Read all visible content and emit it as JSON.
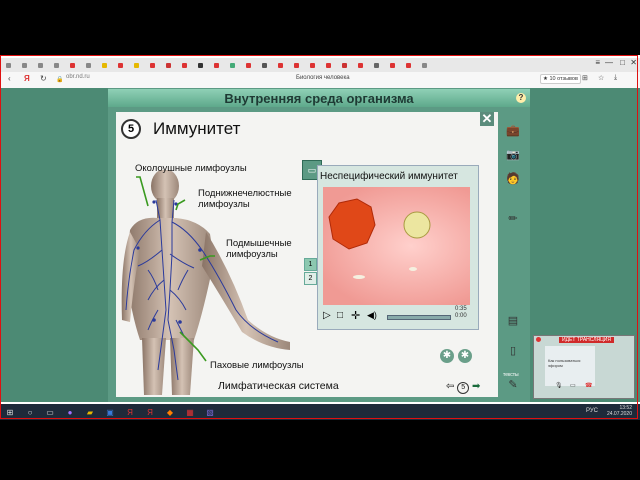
{
  "browser": {
    "url": "obr.nd.ru",
    "page_title": "Биология человека",
    "reviews_badge": "★ 10 отзывов",
    "window_controls": [
      "≡",
      "—",
      "□",
      "✕"
    ],
    "tab_icon_colors": [
      "#888",
      "#888",
      "#888",
      "#888",
      "#d33",
      "#888",
      "#e6b800",
      "#d33",
      "#e6b800",
      "#d33",
      "#c33",
      "#d33",
      "#333",
      "#d33",
      "#4a7",
      "#d33",
      "#555",
      "#d33",
      "#d33",
      "#d33",
      "#d33",
      "#c33",
      "#d33",
      "#666",
      "#d33",
      "#d33",
      "#888"
    ]
  },
  "app": {
    "title": "Внутренняя среда организма",
    "help_label": "?",
    "close_label": "✕",
    "section_number": "5",
    "heading": "Иммунитет",
    "labels": {
      "parotid": "Околоушные лимфоузлы",
      "submandibular_1": "Поднижнечелюстные",
      "submandibular_2": "лимфоузлы",
      "axillary_1": "Подмышечные",
      "axillary_2": "лимфоузлы",
      "inguinal": "Паховые лимфоузлы"
    },
    "caption": "Лимфатическая система",
    "video": {
      "title": "Неспецифический иммунитет",
      "time_total": "0:35",
      "time_current": "0:00",
      "clips": [
        "1",
        "2"
      ],
      "active_clip": 0,
      "progress": 0.0
    },
    "page_number": "5",
    "tools": [
      "briefcase-icon",
      "camera-icon",
      "person-icon",
      "pencil-icon"
    ],
    "lower_tools": [
      "notebook-icon",
      "page-icon",
      "test-icon",
      "note-icon"
    ],
    "test_label": "тексты"
  },
  "overlay": {
    "badge": "ИДЕТ ТРАНСЛЯЦИЯ",
    "line": "Как пользоваться эфиром"
  },
  "taskbar": {
    "time": "13:52",
    "date": "24.07.2020",
    "lang": "РУС"
  }
}
